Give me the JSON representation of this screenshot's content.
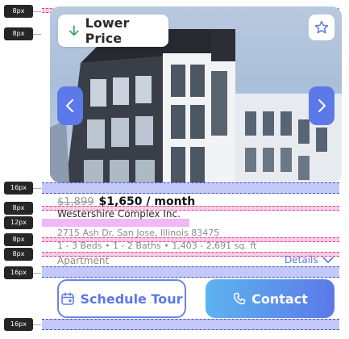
{
  "annotations": {
    "spacing_labels": [
      "8px",
      "8px",
      "16px",
      "8px",
      "12px",
      "8px",
      "8px",
      "16px",
      "16px"
    ]
  },
  "listing": {
    "badge_label": "Lower Price",
    "old_price": "$1,899",
    "price": "$1,650 / month",
    "name": "Westershire Complex Inc.",
    "address": "2715 Ash Dr. San Jose, Illinois 83475",
    "features": "1 - 3 Beds • 1 - 2 Baths • 1,403 - 2,691 sq. ft",
    "type": "Apartment",
    "details_label": "Details"
  },
  "actions": {
    "schedule_label": "Schedule Tour",
    "contact_label": "Contact"
  },
  "icons": {
    "badge": "arrow-down-icon",
    "favorite": "star-icon",
    "prev": "chevron-left-icon",
    "next": "chevron-right-icon",
    "details": "chevron-down-icon",
    "schedule": "calendar-icon",
    "contact": "phone-icon"
  },
  "colors": {
    "accent": "#5b79e8",
    "badge_arrow": "#3aa66b",
    "contact_gradient_start": "#5db4ef",
    "contact_gradient_end": "#5b79e8"
  }
}
